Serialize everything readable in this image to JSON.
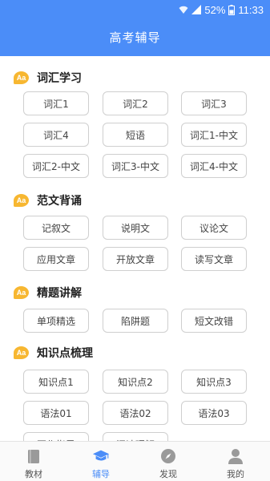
{
  "status_bar": {
    "battery": "52%",
    "time": "11:33"
  },
  "header": {
    "title": "高考辅导"
  },
  "sections": [
    {
      "title": "词汇学习",
      "items": [
        "词汇1",
        "词汇2",
        "词汇3",
        "词汇4",
        "短语",
        "词汇1-中文",
        "词汇2-中文",
        "词汇3-中文",
        "词汇4-中文"
      ]
    },
    {
      "title": "范文背诵",
      "items": [
        "记叙文",
        "说明文",
        "议论文",
        "应用文章",
        "开放文章",
        "读写文章"
      ]
    },
    {
      "title": "精题讲解",
      "items": [
        "单项精选",
        "陷阱题",
        "短文改错"
      ]
    },
    {
      "title": "知识点梳理",
      "items": [
        "知识点1",
        "知识点2",
        "知识点3",
        "语法01",
        "语法02",
        "语法03",
        "写作指导",
        "阅读理解"
      ]
    }
  ],
  "section_icon_label": "Aa",
  "bottom_nav": [
    {
      "label": "教材",
      "icon": "book-icon",
      "active": false
    },
    {
      "label": "辅导",
      "icon": "graduation-cap-icon",
      "active": true
    },
    {
      "label": "发现",
      "icon": "compass-icon",
      "active": false
    },
    {
      "label": "我的",
      "icon": "user-icon",
      "active": false
    }
  ],
  "colors": {
    "primary": "#4b8df8",
    "section_icon": "#f7b731",
    "chip_border": "#cfcfcf"
  }
}
